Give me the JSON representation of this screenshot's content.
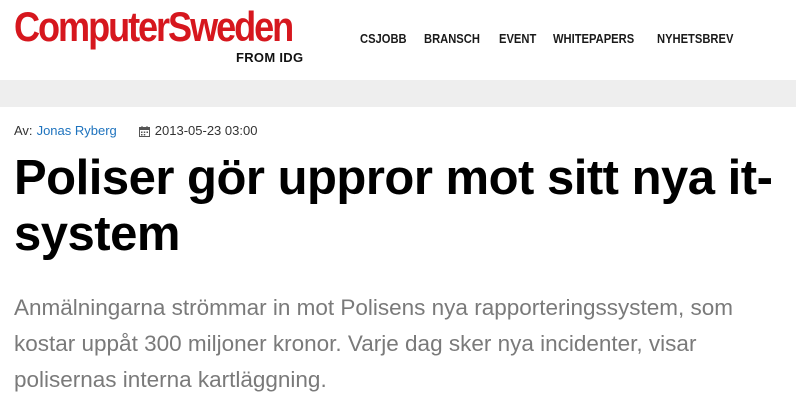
{
  "brand": {
    "logo": "ComputerSweden",
    "sub": "FROM IDG",
    "color": "#d6171e"
  },
  "nav": {
    "items": [
      {
        "label": "CSJOBB"
      },
      {
        "label": "BRANSCH"
      },
      {
        "label": "EVENT"
      },
      {
        "label": "WHITEPAPERS"
      },
      {
        "label": "NYHETSBREV"
      }
    ]
  },
  "article": {
    "author_label": "Av:",
    "author": "Jonas Ryberg",
    "date_icon": "calendar-icon",
    "date": "2013-05-23 03:00",
    "headline": "Poliser gör uppror mot sitt nya it-system",
    "lead": "Anmälningarna strömmar in mot Polisens nya rapporteringssystem, som kostar uppåt 300 miljoner kronor. Varje dag sker nya incidenter, visar polisernas interna kartläggning."
  },
  "colors": {
    "link": "#1e73be",
    "lead_text": "#7a7a7a",
    "band": "#eeeeee"
  }
}
